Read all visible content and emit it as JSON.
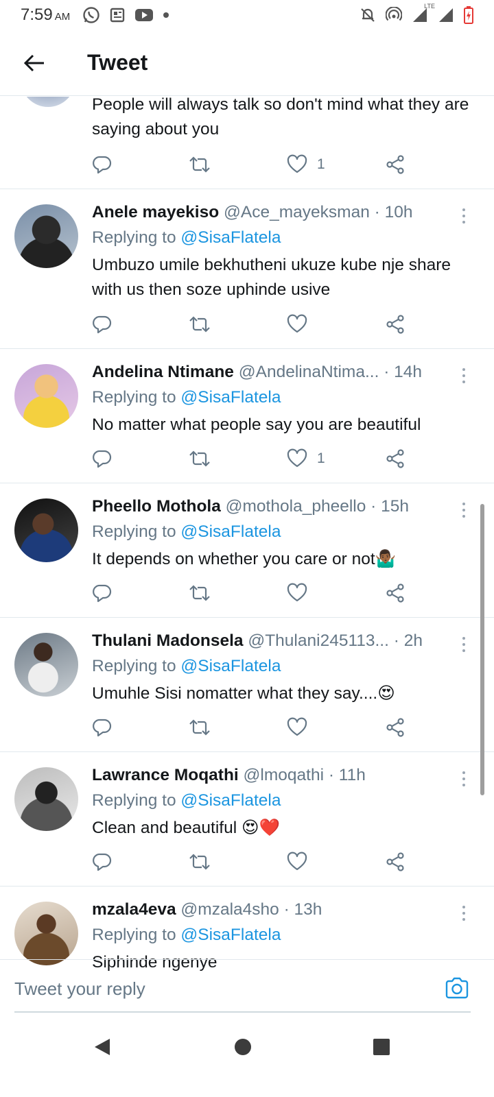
{
  "status_bar": {
    "time": "7:59",
    "ampm": "AM",
    "network": "LTE",
    "icons_left": [
      "whatsapp-icon",
      "news-icon",
      "youtube-icon",
      "dot-icon"
    ],
    "icons_right": [
      "mute-icon",
      "hotspot-icon",
      "signal-lte-icon",
      "signal-icon",
      "battery-low-icon"
    ]
  },
  "header": {
    "title": "Tweet",
    "back_icon": "arrow-left-icon"
  },
  "partial_tweet": {
    "text": "People will always talk so don't mind what they are saying about you",
    "like_count": "1"
  },
  "replying_prefix": "Replying to",
  "replying_handle": "@SisaFlatela",
  "replies": [
    {
      "name": "Anele mayekiso",
      "handle": "@Ace_mayeksman",
      "time": "· 10h",
      "text": "Umbuzo umile bekhutheni ukuze kube nje share with us then soze uphinde usive",
      "likes": ""
    },
    {
      "name": "Andelina Ntimane",
      "handle": "@AndelinaNtima...",
      "time": "· 14h",
      "text": "No matter what people say you are beautiful",
      "likes": "1"
    },
    {
      "name": "Pheello Mothola",
      "handle": "@mothola_pheello",
      "time": "· 15h",
      "text": "It depends on whether you care or not🤷🏾‍♂️",
      "likes": ""
    },
    {
      "name": "Thulani Madonsela",
      "handle": "@Thulani245113...",
      "time": "· 2h",
      "text": "Umuhle Sisi nomatter what they say....😍",
      "likes": ""
    },
    {
      "name": "Lawrance Moqathi",
      "handle": "@lmoqathi",
      "time": "· 11h",
      "text": "Clean and beautiful 😍❤️",
      "likes": ""
    },
    {
      "name": "mzala4eva",
      "handle": "@mzala4sho",
      "time": "· 13h",
      "text": "Siphinde ngenye",
      "likes": ""
    }
  ],
  "reply_bar": {
    "placeholder": "Tweet your reply",
    "camera_icon": "camera-icon"
  },
  "nav_bar": {
    "icons": [
      "nav-back-icon",
      "nav-home-icon",
      "nav-recents-icon"
    ]
  },
  "colors": {
    "link": "#1b95e0",
    "secondary_text": "#657786",
    "divider": "#e1e8ed",
    "camera": "#1b95e0"
  }
}
